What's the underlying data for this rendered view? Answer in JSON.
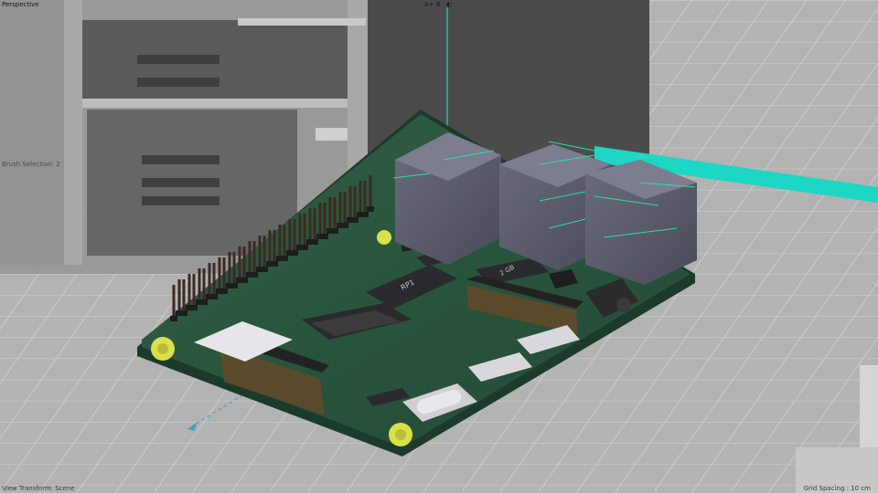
{
  "viewport": {
    "view_name": "Perspective",
    "axis_indicator": "A+ B",
    "toggle_icon": "half-circle-icon",
    "status_left_top": "Brush Selection: 2",
    "status_bottom_left": "View Transform: Scene",
    "grid_spacing": "Grid Spacing : 10 cm"
  },
  "board_chips": [
    {
      "label": "RP1"
    },
    {
      "label": "2 GB"
    }
  ],
  "colors": {
    "background": "#b5b5b5",
    "grid_line": "#d8d8d8",
    "pcb": "#2e5a40",
    "gizmo_y": "#1ed6c4",
    "ethernet_port": "#5a5c6c"
  }
}
